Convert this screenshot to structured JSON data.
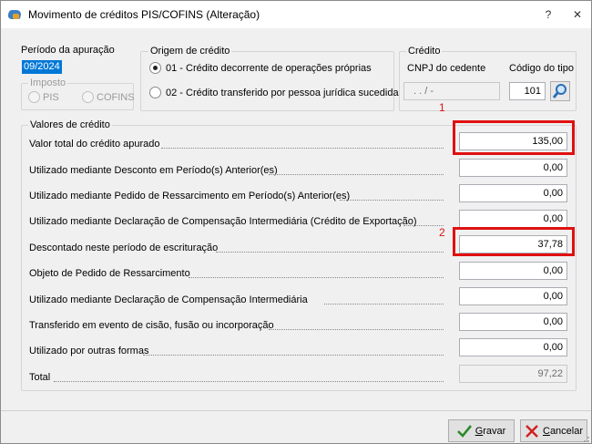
{
  "window": {
    "title": "Movimento de créditos PIS/COFINS (Alteração)"
  },
  "periodo": {
    "label": "Período da apuração",
    "value": "09/2024"
  },
  "imposto": {
    "label": "Imposto",
    "options": [
      "PIS",
      "COFINS"
    ]
  },
  "origem": {
    "label": "Origem de crédito",
    "options": [
      "01 - Crédito decorrente de operações próprias",
      "02 - Crédito transferido por pessoa jurídica sucedida"
    ]
  },
  "credito": {
    "label": "Crédito",
    "cnpj_label": "CNPJ do cedente",
    "cnpj_value": ". . /  -",
    "codigo_label": "Código do tipo",
    "codigo_value": "101"
  },
  "valores": {
    "label": "Valores de crédito",
    "rows": [
      {
        "label": "Valor total do crédito apurado",
        "value": "135,00"
      },
      {
        "label": "Utilizado mediante Desconto em Período(s) Anterior(es)",
        "value": "0,00"
      },
      {
        "label": "Utilizado mediante Pedido de Ressarcimento em  Período(s) Anterior(es)",
        "value": "0,00"
      },
      {
        "label": "Utilizado mediante Declaração de Compensação Intermediária (Crédito de Exportação)",
        "value": "0,00"
      },
      {
        "label": "Descontado neste período de escrituração",
        "value": "37,78"
      },
      {
        "label": "Objeto de Pedido de Ressarcimento",
        "value": "0,00"
      },
      {
        "label": "Utilizado mediante Declaração de Compensação Intermediária",
        "value": "0,00"
      },
      {
        "label": "Transferido em evento de cisão, fusão ou incorporação",
        "value": "0,00"
      },
      {
        "label": "Utilizado por outras formas",
        "value": "0,00"
      },
      {
        "label": "Total",
        "value": "97,22"
      }
    ]
  },
  "annotations": {
    "one": "1",
    "two": "2"
  },
  "buttons": {
    "save_accel": "G",
    "save_rest": "ravar",
    "cancel_accel": "C",
    "cancel_rest": "ancelar"
  }
}
